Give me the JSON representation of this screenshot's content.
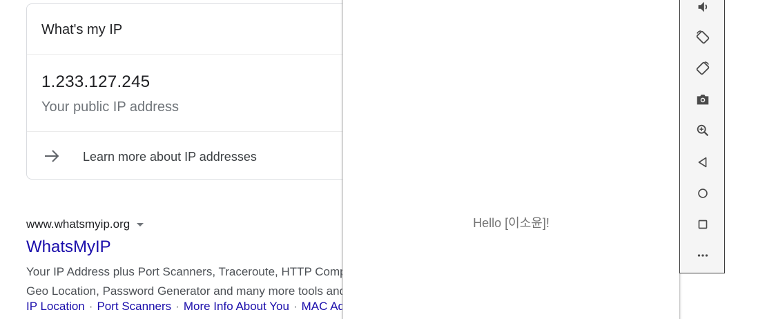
{
  "card": {
    "query": "What's my IP",
    "ip": "1.233.127.245",
    "ip_label": "Your public IP address",
    "learn_more": "Learn more about IP addresses"
  },
  "result": {
    "cite": "www.whatsmyip.org",
    "title": "WhatsMyIP",
    "snippet_line1": "Your IP Address plus Port Scanners, Traceroute, HTTP Compression",
    "snippet_line2": "Geo Location, Password Generator and many more tools and",
    "sitelinks": [
      "IP Location",
      "Port Scanners",
      "More Info About You",
      "MAC Address"
    ]
  },
  "emulator": {
    "greeting": "Hello [이소윤]!"
  },
  "toolbar": {
    "icons": [
      "volume-down-icon",
      "rotate-left-icon",
      "rotate-right-icon",
      "camera-icon",
      "zoom-icon",
      "back-icon",
      "home-icon",
      "overview-icon",
      "more-icon"
    ]
  },
  "colors": {
    "link": "#1a0dab",
    "secondary_text": "#70757a",
    "toolbar_icon": "#4a4a4a"
  }
}
